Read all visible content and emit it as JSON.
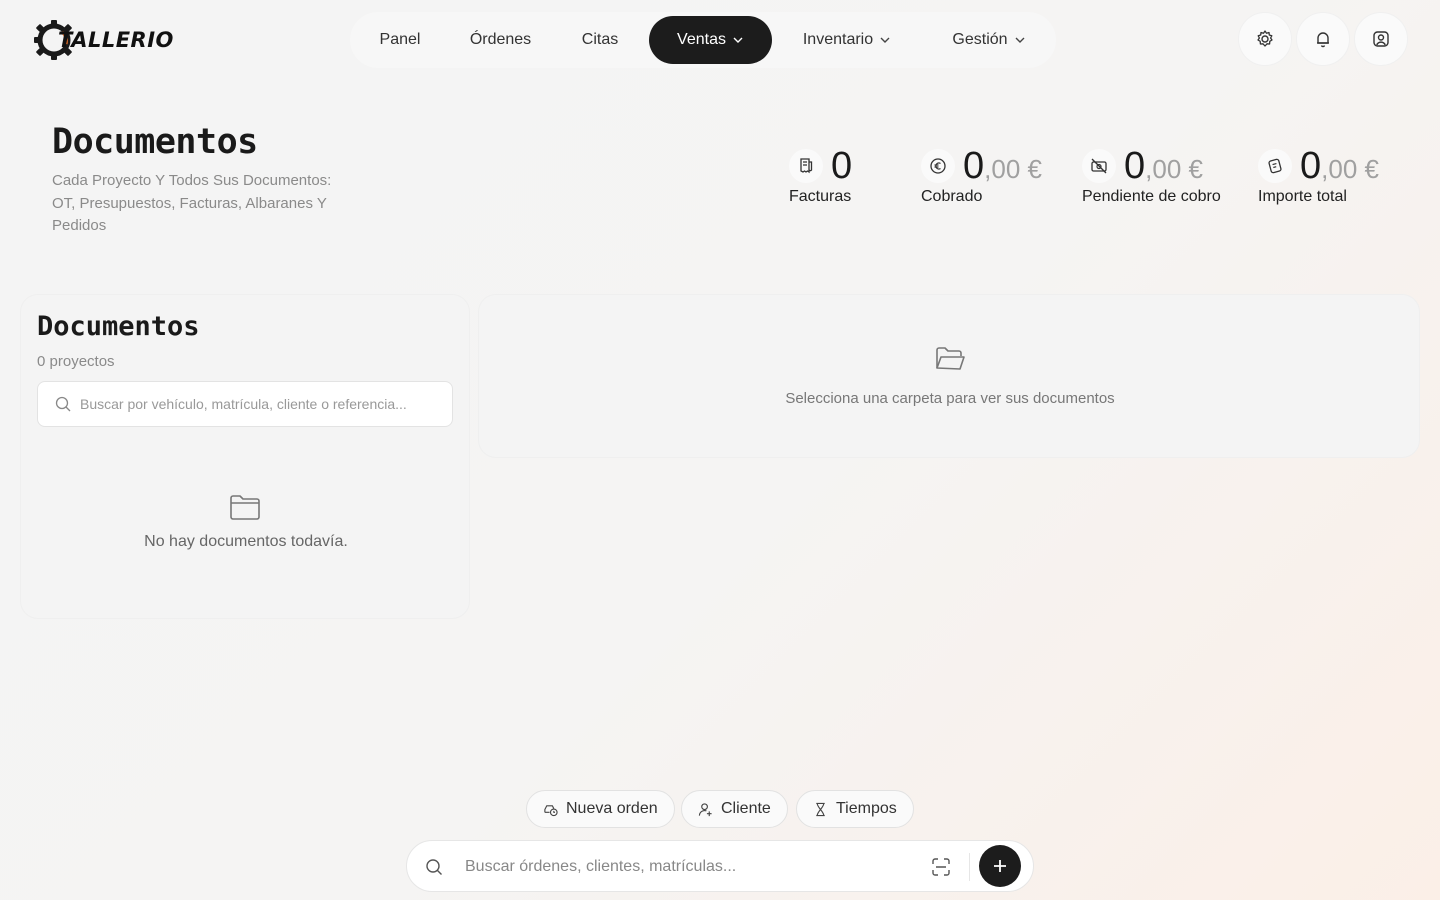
{
  "brand": {
    "name": "TALLERIO",
    "accent": "#e8702a"
  },
  "nav": {
    "items": [
      {
        "label": "Panel",
        "dropdown": false,
        "active": false
      },
      {
        "label": "Órdenes",
        "dropdown": false,
        "active": false
      },
      {
        "label": "Citas",
        "dropdown": false,
        "active": false
      },
      {
        "label": "Ventas",
        "dropdown": true,
        "active": true
      },
      {
        "label": "Inventario",
        "dropdown": true,
        "active": false
      },
      {
        "label": "Gestión",
        "dropdown": true,
        "active": false
      }
    ]
  },
  "header_actions": {
    "icons": [
      "settings-icon",
      "bell-icon",
      "user-icon"
    ]
  },
  "page": {
    "title": "Documentos",
    "subtitle": "Cada Proyecto Y Todos Sus Documentos: OT, Presupuestos, Facturas, Albaranes Y Pedidos"
  },
  "stats": [
    {
      "icon": "receipt-icon",
      "value": "0",
      "fraction": "",
      "label": "Facturas"
    },
    {
      "icon": "euro-icon",
      "value": "0",
      "fraction": ",00 €",
      "label": "Cobrado"
    },
    {
      "icon": "money-off-icon",
      "value": "0",
      "fraction": ",00 €",
      "label": "Pendiente de cobro"
    },
    {
      "icon": "wallet-icon",
      "value": "0",
      "fraction": ",00 €",
      "label": "Importe total"
    }
  ],
  "projects_panel": {
    "title": "Documentos",
    "count": "0 proyectos",
    "search_placeholder": "Buscar por vehículo, matrícula, cliente o referencia...",
    "empty_text": "No hay documentos todavía."
  },
  "documents_panel": {
    "empty_text": "Selecciona una carpeta para ver sus documentos"
  },
  "quick_actions": [
    {
      "label": "Nueva orden",
      "icon": "car-clock-icon"
    },
    {
      "label": "Cliente",
      "icon": "user-add-icon"
    },
    {
      "label": "Tiempos",
      "icon": "hourglass-icon"
    }
  ],
  "global_search": {
    "placeholder": "Buscar órdenes, clientes, matrículas..."
  }
}
